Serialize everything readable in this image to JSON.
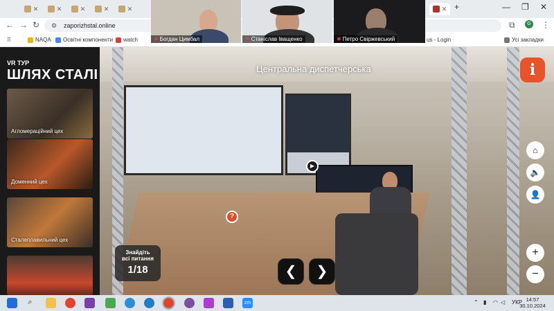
{
  "browser": {
    "url": "zaporizhstal.online",
    "tabs": [
      "",
      "",
      "",
      "",
      "",
      "",
      "",
      ""
    ],
    "window_controls": [
      "—",
      "❐",
      "✕"
    ],
    "bookmarks": [
      {
        "label": "NAQA"
      },
      {
        "label": "Освітні компоненти"
      },
      {
        "label": "watch"
      },
      {
        "label": "us - Login"
      }
    ],
    "bookmarks_folder": "Усі закладки",
    "profile_initial": "G"
  },
  "zoom": {
    "participants": [
      {
        "name": "Богдан Цимбал"
      },
      {
        "name": "Станіслав Іващенко"
      },
      {
        "name": "Петро Свіржевський"
      }
    ]
  },
  "sidebar": {
    "subtitle": "VR ТУР",
    "title": "ШЛЯХ СТАЛІ",
    "items": [
      {
        "label": "Агломераційний цех"
      },
      {
        "label": "Доменний цех"
      },
      {
        "label": "Сталеплавильний цех"
      },
      {
        "label": ""
      }
    ]
  },
  "scene": {
    "title": "Центральна диспетчерська",
    "info_label": "i",
    "questions": {
      "line1": "Знайдіть",
      "line2": "всі питання",
      "counter": "1/18"
    },
    "hotspot_question": "?",
    "hotspot_play": "▶",
    "prev_label": "❮",
    "next_label": "❯",
    "zoom_in": "+",
    "zoom_out": "−"
  },
  "taskbar": {
    "language": "УКР",
    "time": "14:57",
    "date": "30.10.2024"
  }
}
